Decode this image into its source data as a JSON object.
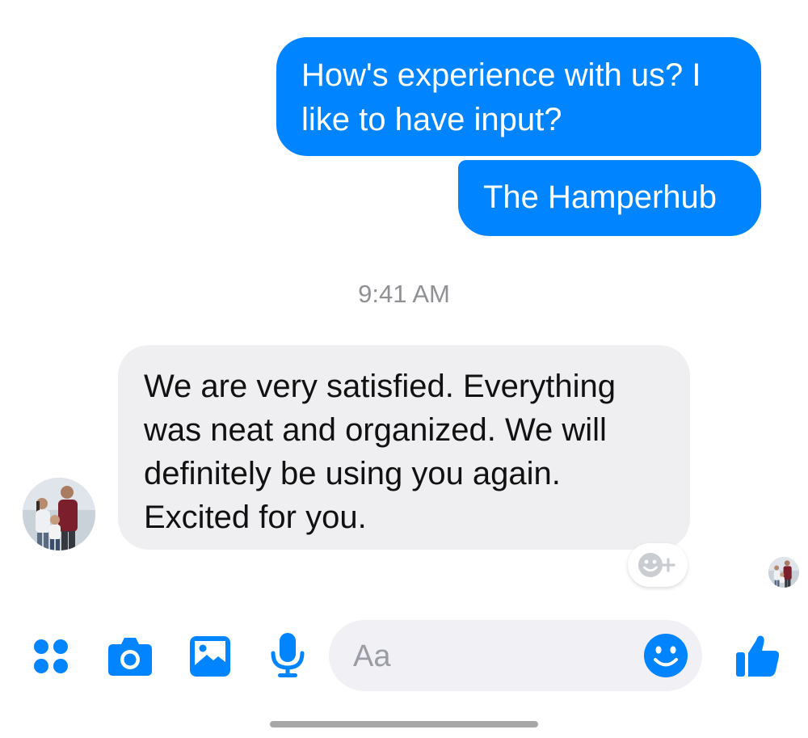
{
  "conversation": {
    "messages": [
      {
        "direction": "outgoing",
        "text": "How's experience with us? I like to have input?"
      },
      {
        "direction": "outgoing",
        "text": "The Hamperhub"
      },
      {
        "direction": "incoming",
        "text": "We are very satisfied. Everything was neat and organized. We will definitely be using you again. Excited for you."
      }
    ],
    "timestamp": "9:41 AM"
  },
  "composer": {
    "placeholder": "Aa",
    "icons": [
      "apps-icon",
      "camera-icon",
      "gallery-icon",
      "microphone-icon",
      "emoji-icon",
      "thumbs-up-icon"
    ]
  },
  "colors": {
    "accent": "#0084ff",
    "incoming_bubble": "#efeff1",
    "composer_bg": "#f1f0f5"
  }
}
